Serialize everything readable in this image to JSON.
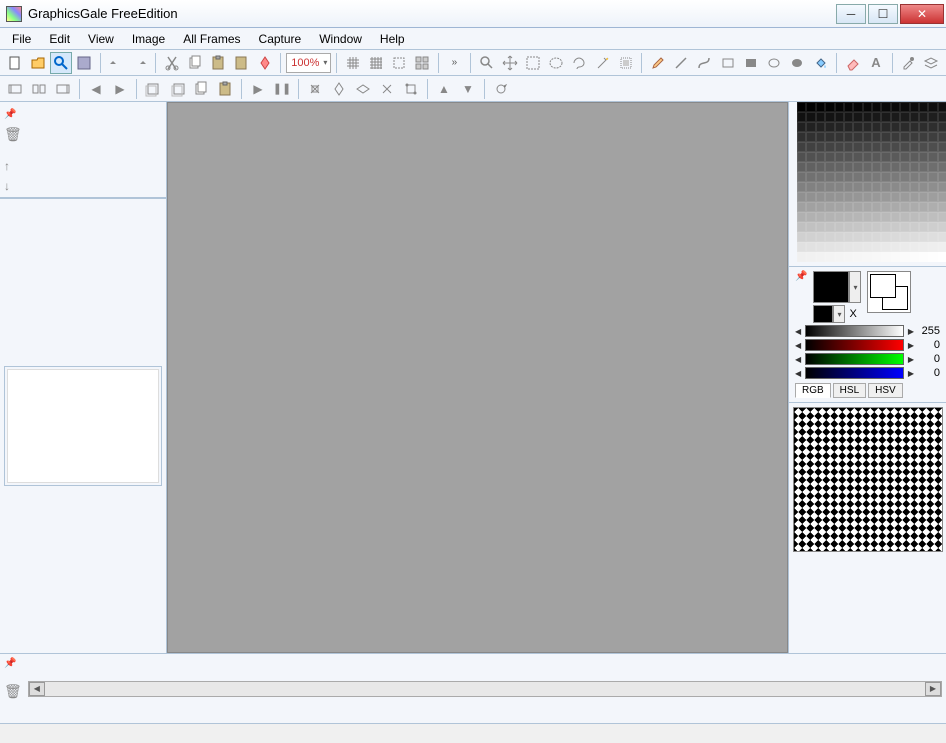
{
  "titlebar": {
    "title": "GraphicsGale FreeEdition"
  },
  "menu": [
    "File",
    "Edit",
    "View",
    "Image",
    "All Frames",
    "Capture",
    "Window",
    "Help"
  ],
  "toolbar1": {
    "zoom": "100%"
  },
  "colors": {
    "v": 255,
    "r": 0,
    "g": 0,
    "b": 0,
    "modes": [
      "RGB",
      "HSL",
      "HSV"
    ],
    "x_label": "X"
  }
}
